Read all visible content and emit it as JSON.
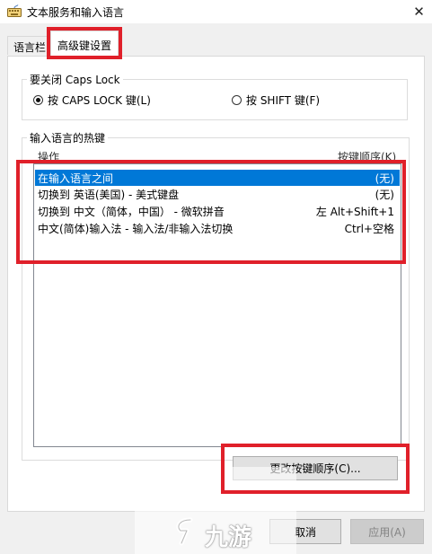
{
  "window": {
    "title": "文本服务和输入语言"
  },
  "tabs": [
    {
      "label": "语言栏"
    },
    {
      "label": "高级键设置"
    }
  ],
  "caps_lock": {
    "group_title": "要关闭 Caps Lock",
    "option_caps": "按 CAPS LOCK 键(L)",
    "option_shift": "按 SHIFT 键(F)",
    "selected": "option_caps"
  },
  "hotkeys": {
    "group_title": "输入语言的热键",
    "col_action": "操作",
    "col_sequence": "按键顺序(K)",
    "rows": [
      {
        "action": "在输入语言之间",
        "keys": "(无)",
        "selected": true
      },
      {
        "action": "切换到 英语(美国) - 美式键盘",
        "keys": "(无)",
        "selected": false
      },
      {
        "action": "切换到 中文（简体，中国） - 微软拼音",
        "keys": "左 Alt+Shift+1",
        "selected": false
      },
      {
        "action": "中文(简体)输入法 - 输入法/非输入法切换",
        "keys": "Ctrl+空格",
        "selected": false
      }
    ]
  },
  "buttons": {
    "change_sequence": "更改按键顺序(C)...",
    "cancel": "取消",
    "apply": "应用(A)"
  },
  "watermark": {
    "text": "九游"
  },
  "colors": {
    "selection": "#0078d7",
    "annotation": "#e0202a"
  }
}
